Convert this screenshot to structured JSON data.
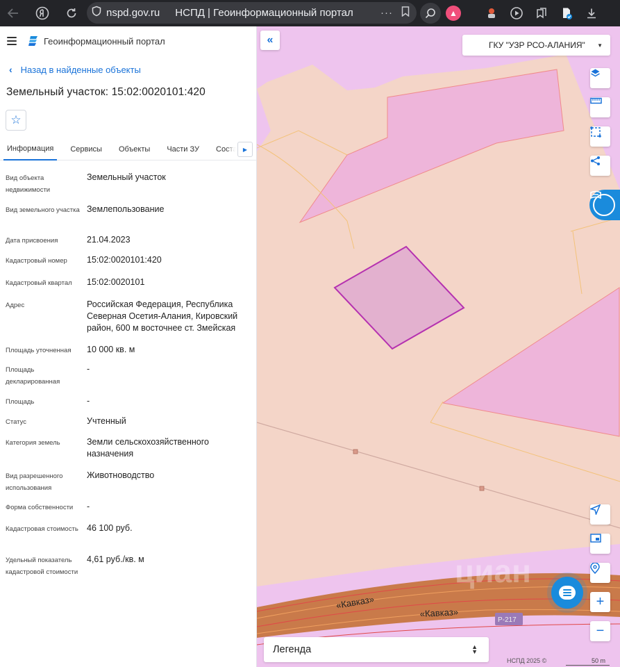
{
  "browser": {
    "url": "nspd.gov.ru",
    "tab_title": "НСПД | Геоинформационный портал",
    "more": "···"
  },
  "header": {
    "portal_title": "Геоинформационный портал"
  },
  "nav": {
    "back_label": "Назад в найденные объекты"
  },
  "object": {
    "title": "Земельный участок: 15:02:0020101:420",
    "favorite_icon": "☆"
  },
  "tabs": [
    {
      "label": "Информация",
      "active": true
    },
    {
      "label": "Сервисы"
    },
    {
      "label": "Объекты"
    },
    {
      "label": "Части ЗУ"
    },
    {
      "label": "Состав"
    }
  ],
  "info": [
    {
      "label": "Вид объекта недвижимости",
      "value": "Земельный участок"
    },
    {
      "label": "Вид земельного участка",
      "value": "Землепользование"
    },
    {
      "label": "Дата присвоения",
      "value": "21.04.2023"
    },
    {
      "label": "Кадастровый номер",
      "value": "15:02:0020101:420"
    },
    {
      "label": "Кадастровый квартал",
      "value": "15:02:0020101"
    },
    {
      "label": "Адрес",
      "value": "Российская Федерация, Республика Северная Осетия-Алания, Кировский район, 600 м восточнее ст. Змейская"
    },
    {
      "label": "Площадь уточненная",
      "value": "10 000 кв. м"
    },
    {
      "label": "Площадь декларированная",
      "value": "-"
    },
    {
      "label": "Площадь",
      "value": "-"
    },
    {
      "label": "Статус",
      "value": "Учтенный"
    },
    {
      "label": "Категория земель",
      "value": "Земли сельскохозяйственного назначения"
    },
    {
      "label": "Вид разрешенного использования",
      "value": "Животноводство"
    },
    {
      "label": "Форма собственности",
      "value": "-"
    },
    {
      "label": "Кадастровая стоимость",
      "value": "46 100 руб."
    },
    {
      "label": "Удельный показатель кадастровой стоимости",
      "value": "4,61 руб./кв. м"
    }
  ],
  "map": {
    "org_select": "ГКУ \"УЗР РСО-АЛАНИЯ\"",
    "collapse_icon": "«",
    "road_label_1": "«Кавказ»",
    "road_label_2": "«Кавказ»",
    "road_number": "Р-217",
    "watermark": "циан",
    "legend_label": "Легенда",
    "copyright": "НСПД 2025 ©",
    "scale_label": "50 m",
    "zoom_in": "+",
    "zoom_out": "−"
  },
  "colors": {
    "accent": "#1a73d9",
    "map_base": "#f4d5c8",
    "parcel_pink": "#eeb5da",
    "selected_parcel": "#e3b1cf",
    "selected_stroke": "#b531b0"
  }
}
